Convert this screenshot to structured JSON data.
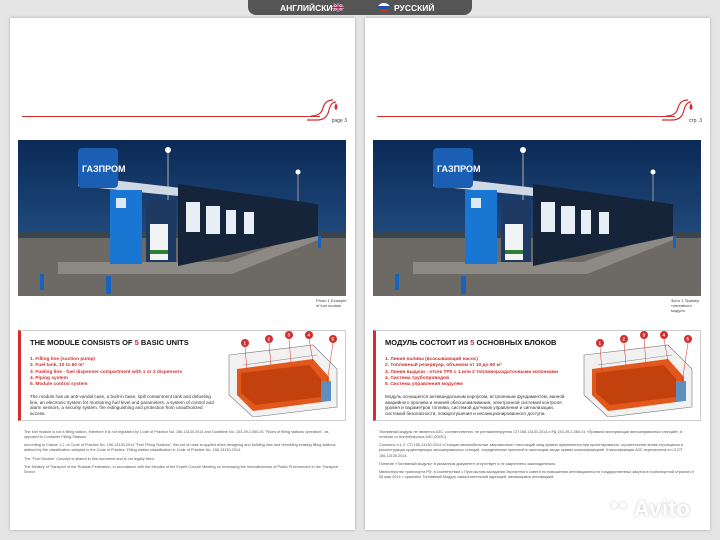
{
  "langbar": {
    "left_lang": "АНГЛИЙСКИЙ",
    "right_lang": "РУССКИЙ"
  },
  "colors": {
    "accent": "#d32f2f",
    "sky": "#0d2b52",
    "brand_blue": "#1565c0"
  },
  "pages": {
    "en": {
      "page_number": "page 3",
      "caption": "Photo 1 Example of fuel module",
      "title_before": "THE MODULE CONSISTS OF ",
      "title_num": "5",
      "title_after": " BASIC UNITS",
      "items": [
        "1. Filling line (suction pump)",
        "2. Fuel tank, 10 to 60 m³",
        "3. Fueling line - fuel dispenser compartment with 1 or 2 dispensers",
        "4. Piping system",
        "5. Module control system"
      ],
      "description": "The module has an anti-vandal case, a built-in base, spill containment tank and defueling line, an electronic system for monitoring fuel level and parameters, a system of control and alarm sensors, a security system, fire extinguishing and protection from unauthorized access.",
      "notes": [
        "The fuel module is not a filling station, therefore it is not regulated by Code of Practice No. 156.13130.2014 and Guideline No. 153-39.2-080-01 \"Rules of filling stations operation\", as opposed to Container Filling Stations.",
        "According to Clause 1.2. of Code of Practice No. 156.13130.2014 \"Fuel Filling Stations\", this set of rules is applied when designing and building new and rebuilding existing filling stations defined by the classification adopted in the Code of Practice. Filling station classification in Code of Practice No. 156.13130.2014.",
        "The \"Fuel Module\" Concept is absent in this document and is not legally fixed.",
        "The Ministry of Transport of the Russian Federation, in accordance with the Minutes of the Expert Council Meeting on Increasing the Innovativeness of Public Procurement in the Transport Sector"
      ]
    },
    "ru": {
      "page_number": "стр. 3",
      "caption": "Фото 1 Пример топливного модуля",
      "title_before": "МОДУЛЬ СОСТОИТ ИЗ ",
      "title_num": "5",
      "title_after": " ОСНОВНЫХ БЛОКОВ",
      "items": [
        "1. Линия налива (всасывающий насос)",
        "2. Топливный резервуар, объемом от 10 до 60 м³",
        "3. Линия выдачи - отсек ТРК с 1 или 2 топливораздаточными колонками",
        "4. Система трубопроводов",
        "5. Система управления модулем"
      ],
      "description": "Модуль оснащается антивандальным корпусом, встроенным фундаментом, ванной аварийного пролива и линией обесшламливания, электронной системой контроля уровня и параметров топлива, системой датчиков управления и сигнализации, системой безопасности, пожаротушения и несанкционированного доступа.",
      "notes": [
        "Топливный модуль не является АЗС, соответственно, не регламентируется СП 156.13130.2014 и РД 153-39.2-080-01 «Правила эксплуатации автозаправочных станций», в отличие от Контейнерных АЗС (КАЗС).",
        "Согласно п.1.2. СП 156.13130.2014 «Станции автомобильные заправочные» настоящий свод правил применяется при проектировании, строительстве вновь строящихся и реконструкции существующих автозаправочных станций, определенных принятой в настоящем своде правил классификацией. Классификация АЗС перечислена в п.3 СП 156.13130.2014.",
        "Понятие «Топливный модуль» в указанном документе отсутствует и не закреплено законодательно.",
        "Министерство транспорта РФ, в соответствии с Протоколом заседания Экспертного совета по повышению инновационности государственных закупок в транспортной отрасли от 08 мая 2014 г. признало Топливный Модуль самостоятельной единицей, являющимся инновацией."
      ]
    }
  }
}
